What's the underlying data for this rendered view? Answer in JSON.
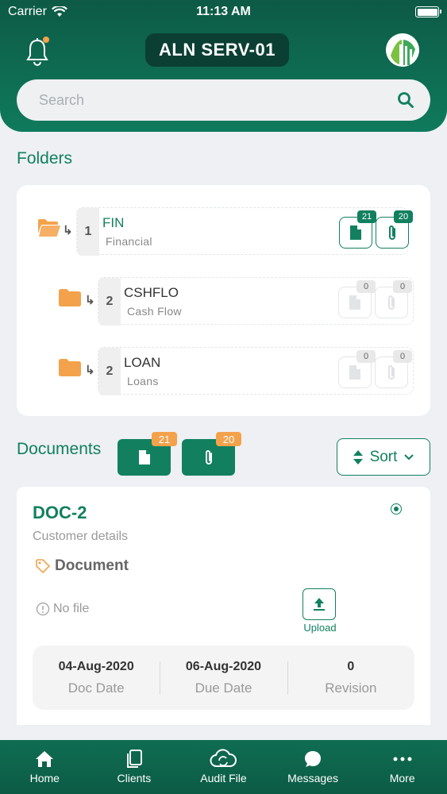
{
  "status_bar": {
    "carrier": "Carrier",
    "time": "11:13 AM"
  },
  "header": {
    "title": "ALN SERV-01"
  },
  "search": {
    "placeholder": "Search"
  },
  "folders": {
    "heading": "Folders",
    "items": [
      {
        "level": "1",
        "code": "FIN",
        "name": "Financial",
        "doc_count": "21",
        "attach_count": "20",
        "enabled": true
      },
      {
        "level": "2",
        "code": "CSHFLO",
        "name": "Cash Flow",
        "doc_count": "0",
        "attach_count": "0",
        "enabled": false
      },
      {
        "level": "2",
        "code": "LOAN",
        "name": "Loans",
        "doc_count": "0",
        "attach_count": "0",
        "enabled": false
      }
    ]
  },
  "documents": {
    "heading": "Documents",
    "doc_count": "21",
    "attach_count": "20",
    "sort_label": "Sort"
  },
  "doc_card": {
    "title": "DOC-2",
    "subtitle": "Customer details",
    "type_label": "Document",
    "no_file_label": "No file",
    "upload_label": "Upload",
    "doc_date": "04-Aug-2020",
    "doc_date_label": "Doc Date",
    "due_date": "06-Aug-2020",
    "due_date_label": "Due Date",
    "revision": "0",
    "revision_label": "Revision"
  },
  "tabs": [
    {
      "label": "Home",
      "icon": "home-icon"
    },
    {
      "label": "Clients",
      "icon": "clients-icon"
    },
    {
      "label": "Audit File",
      "icon": "cloud-sync-icon"
    },
    {
      "label": "Messages",
      "icon": "chat-icon"
    },
    {
      "label": "More",
      "icon": "more-icon"
    }
  ],
  "colors": {
    "primary": "#12805f",
    "header_dark": "#0b3f33",
    "accent": "#f3a24b",
    "folder": "#f3a24b"
  }
}
